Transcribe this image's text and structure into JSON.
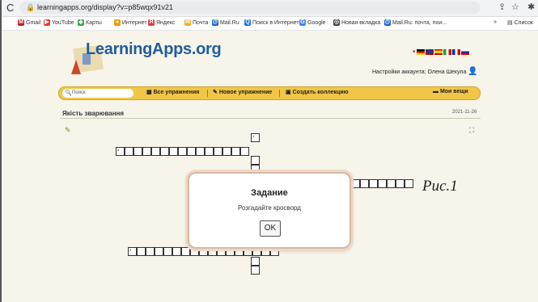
{
  "browser": {
    "url": "learningapps.org/display?v=p85wqx91v21",
    "bookmarks": [
      {
        "label": "Gmail",
        "icon": "gmail-icon",
        "color": "#c5221f",
        "glyph": "M"
      },
      {
        "label": "YouTube",
        "icon": "youtube-icon",
        "color": "#e53935",
        "glyph": "▶"
      },
      {
        "label": "Карты",
        "icon": "maps-icon",
        "color": "#34a853",
        "glyph": "◆"
      },
      {
        "label": "Интернет",
        "icon": "internet-icon",
        "color": "#f29900",
        "glyph": "●"
      },
      {
        "label": "Яндекс",
        "icon": "yandex-icon",
        "color": "#e53935",
        "glyph": "Я"
      },
      {
        "label": "Почта",
        "icon": "mail-icon",
        "color": "#f9a825",
        "glyph": "✉"
      },
      {
        "label": "Mail.Ru",
        "icon": "mailru-icon",
        "color": "#1565c0",
        "glyph": "@"
      },
      {
        "label": "Поиск в Интернете",
        "icon": "search-web-icon",
        "color": "#1a73e8",
        "glyph": "Q"
      },
      {
        "label": "Google",
        "icon": "google-icon",
        "color": "#4285f4",
        "glyph": "G"
      },
      {
        "label": "Новая вкладка",
        "icon": "newtab-icon",
        "color": "#444444",
        "glyph": "◎"
      },
      {
        "label": "Mail.Ru: почта, пои...",
        "icon": "mailru-icon",
        "color": "#1565c0",
        "glyph": "@"
      }
    ],
    "more": "»",
    "reading_list": "Список"
  },
  "site": {
    "logo": "LearningApps.org",
    "account": "Настройки аккаунта: Олена Шекула",
    "search_placeholder": "Поиск",
    "nav": [
      "Все упражнения",
      "Новое упражнение",
      "Создать коллекцию"
    ],
    "my_things": "Мои вещи",
    "title": "Якість зварювання",
    "date": "2021-11-26"
  },
  "crossword": {
    "clue_numbers": [
      "1",
      "3",
      "4"
    ]
  },
  "modal": {
    "title": "Задание",
    "body": "Розгадайте кросворд",
    "ok": "OK"
  },
  "caption": "Рис.1"
}
